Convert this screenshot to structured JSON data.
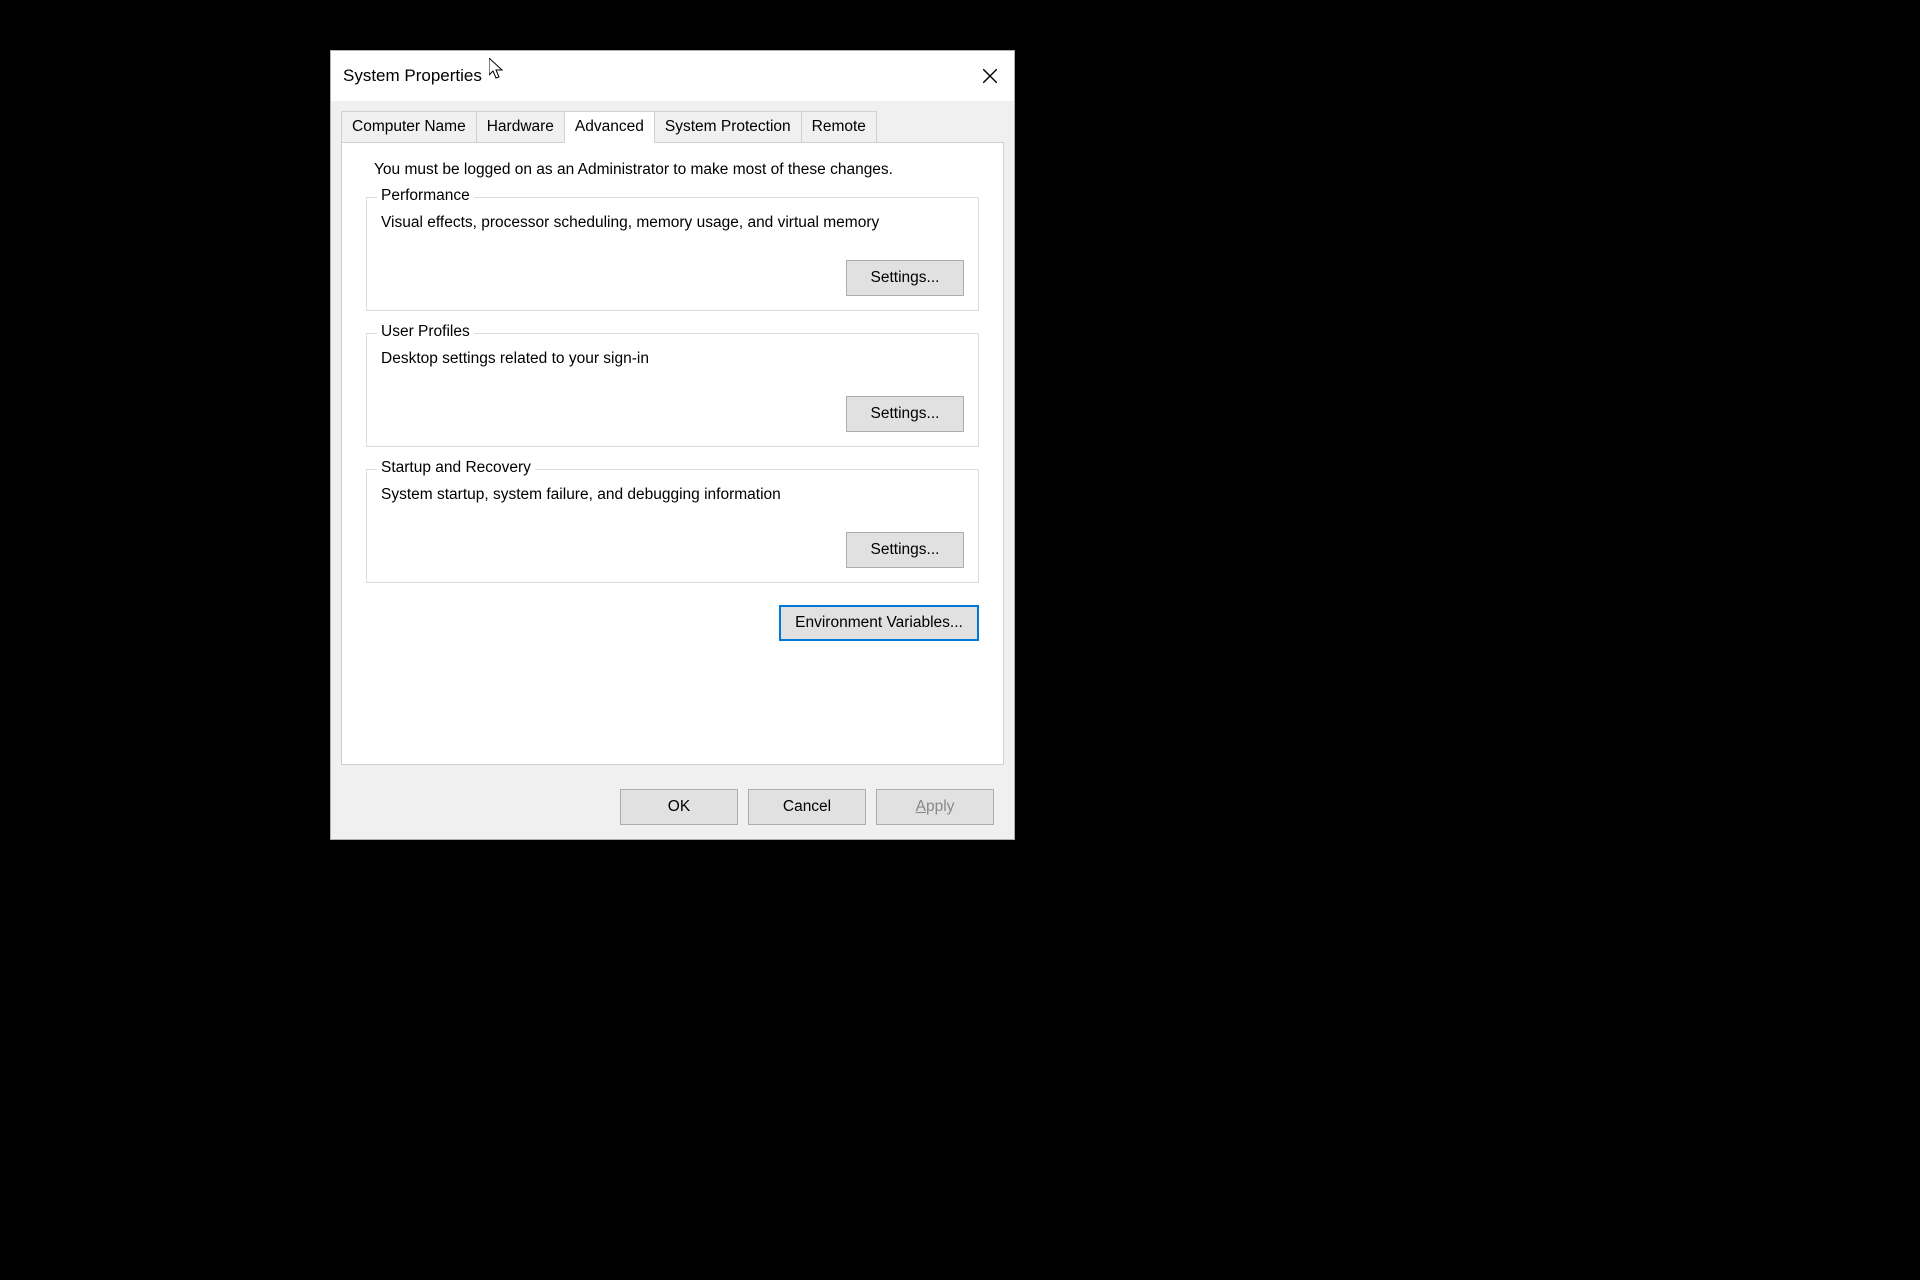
{
  "dialog": {
    "title": "System Properties",
    "close_label": "Close"
  },
  "tabs": [
    {
      "label": "Computer Name",
      "active": false
    },
    {
      "label": "Hardware",
      "active": false
    },
    {
      "label": "Advanced",
      "active": true
    },
    {
      "label": "System Protection",
      "active": false
    },
    {
      "label": "Remote",
      "active": false
    }
  ],
  "advanced": {
    "admin_note": "You must be logged on as an Administrator to make most of these changes.",
    "performance": {
      "legend": "Performance",
      "desc": "Visual effects, processor scheduling, memory usage, and virtual memory",
      "button": "Settings..."
    },
    "user_profiles": {
      "legend": "User Profiles",
      "desc": "Desktop settings related to your sign-in",
      "button": "Settings..."
    },
    "startup_recovery": {
      "legend": "Startup and Recovery",
      "desc": "System startup, system failure, and debugging information",
      "button": "Settings..."
    },
    "env_button": "Environment Variables..."
  },
  "buttons": {
    "ok": "OK",
    "cancel": "Cancel",
    "apply": "Apply"
  }
}
